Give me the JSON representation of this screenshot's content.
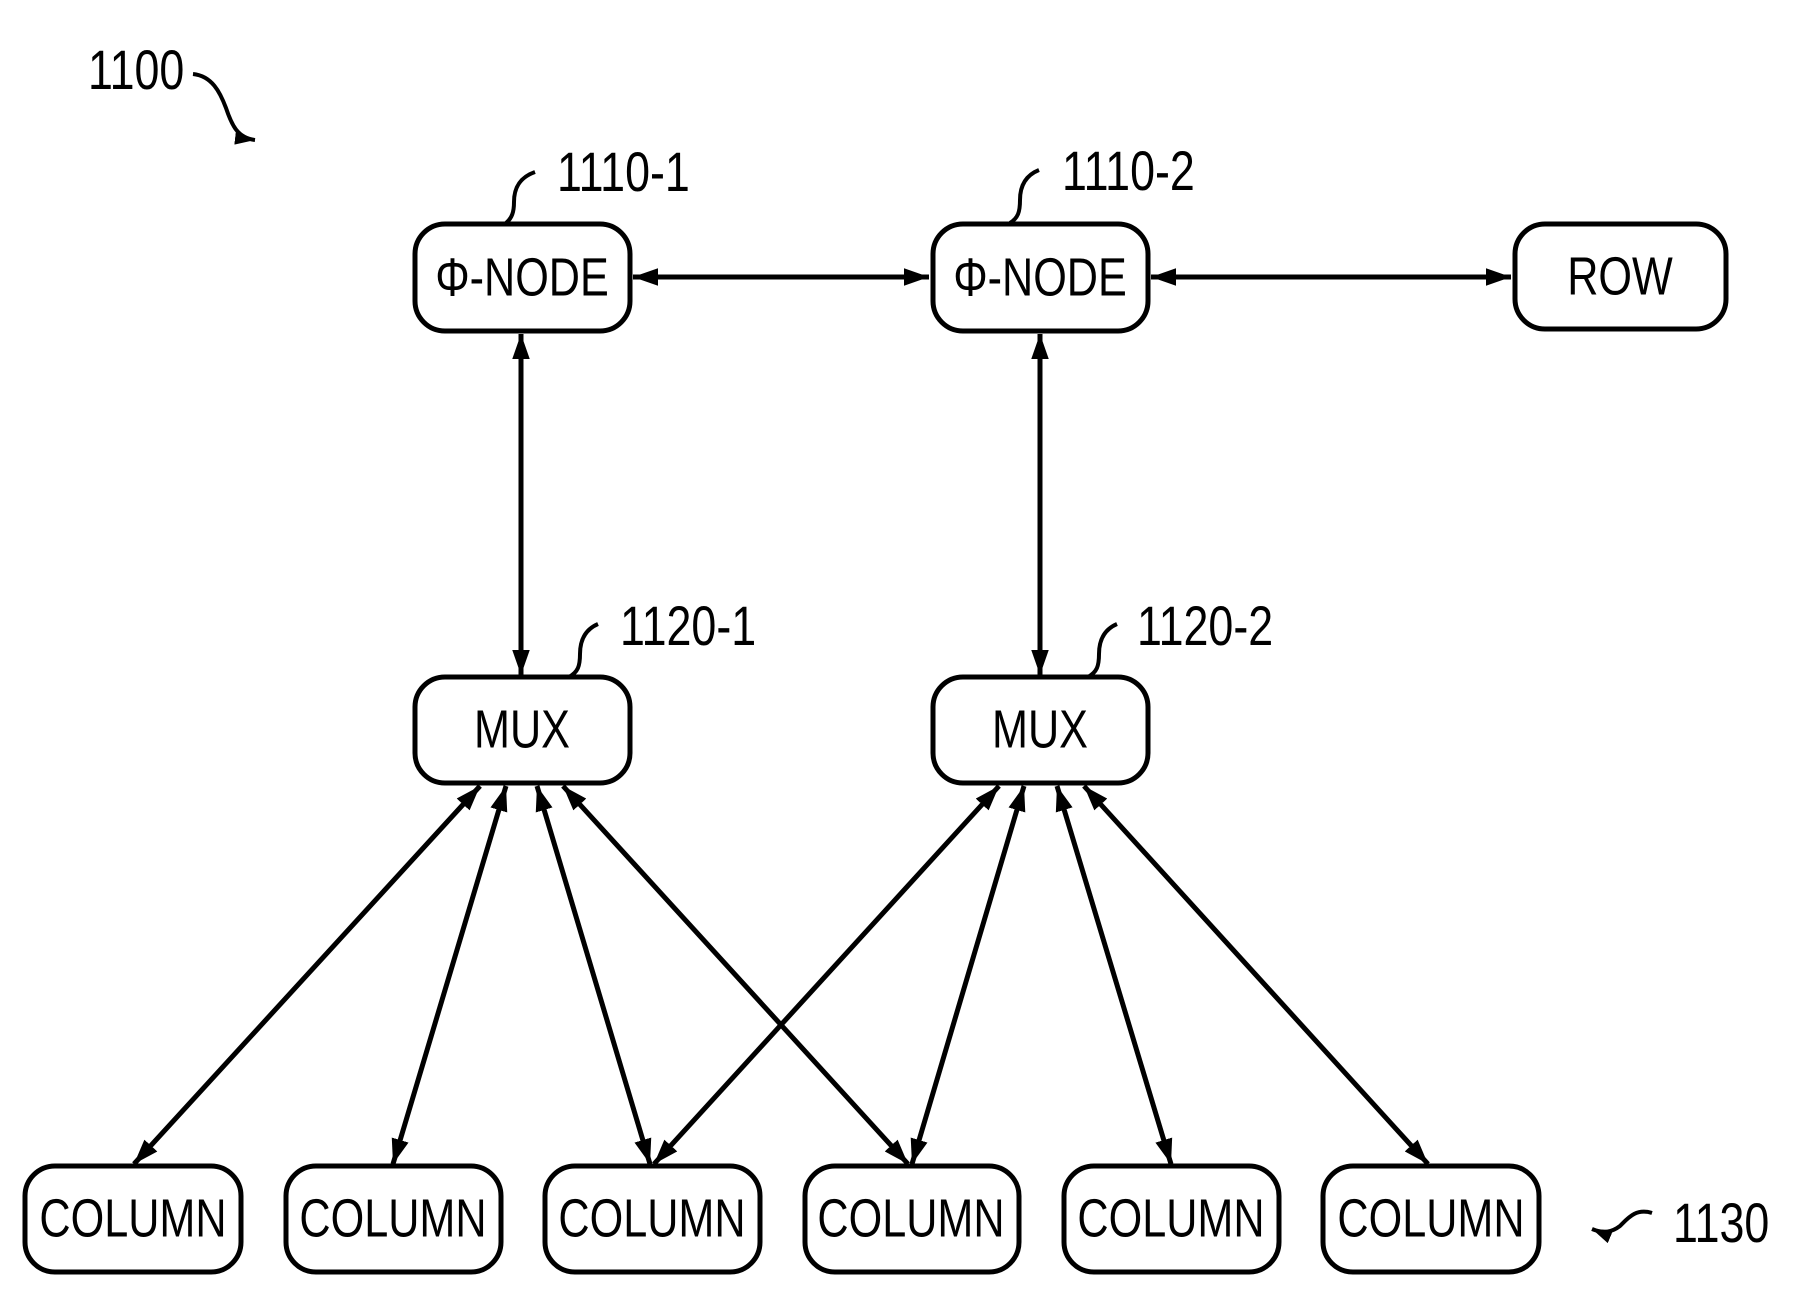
{
  "figure": {
    "reference": "1100"
  },
  "nodes": [
    {
      "id": "phi1",
      "label": "Φ-NODE",
      "ref": "1110-1"
    },
    {
      "id": "phi2",
      "label": "Φ-NODE",
      "ref": "1110-2"
    },
    {
      "id": "row",
      "label": "ROW",
      "ref": ""
    },
    {
      "id": "mux1",
      "label": "MUX",
      "ref": "1120-1"
    },
    {
      "id": "mux2",
      "label": "MUX",
      "ref": "1120-2"
    },
    {
      "id": "col1",
      "label": "COLUMN",
      "ref": ""
    },
    {
      "id": "col2",
      "label": "COLUMN",
      "ref": ""
    },
    {
      "id": "col3",
      "label": "COLUMN",
      "ref": ""
    },
    {
      "id": "col4",
      "label": "COLUMN",
      "ref": ""
    },
    {
      "id": "col5",
      "label": "COLUMN",
      "ref": ""
    },
    {
      "id": "col6",
      "label": "COLUMN",
      "ref": ""
    }
  ],
  "column_group_ref": "1130",
  "edges": [
    {
      "from": "phi1",
      "to": "phi2",
      "direction": "bidirectional"
    },
    {
      "from": "phi2",
      "to": "row",
      "direction": "bidirectional"
    },
    {
      "from": "phi1",
      "to": "mux1",
      "direction": "bidirectional"
    },
    {
      "from": "phi2",
      "to": "mux2",
      "direction": "bidirectional"
    },
    {
      "from": "mux1",
      "to": "col1",
      "direction": "bidirectional"
    },
    {
      "from": "mux1",
      "to": "col2",
      "direction": "bidirectional"
    },
    {
      "from": "mux1",
      "to": "col3",
      "direction": "bidirectional"
    },
    {
      "from": "mux1",
      "to": "col4",
      "direction": "bidirectional"
    },
    {
      "from": "mux2",
      "to": "col3",
      "direction": "bidirectional"
    },
    {
      "from": "mux2",
      "to": "col4",
      "direction": "bidirectional"
    },
    {
      "from": "mux2",
      "to": "col5",
      "direction": "bidirectional"
    },
    {
      "from": "mux2",
      "to": "col6",
      "direction": "bidirectional"
    }
  ]
}
